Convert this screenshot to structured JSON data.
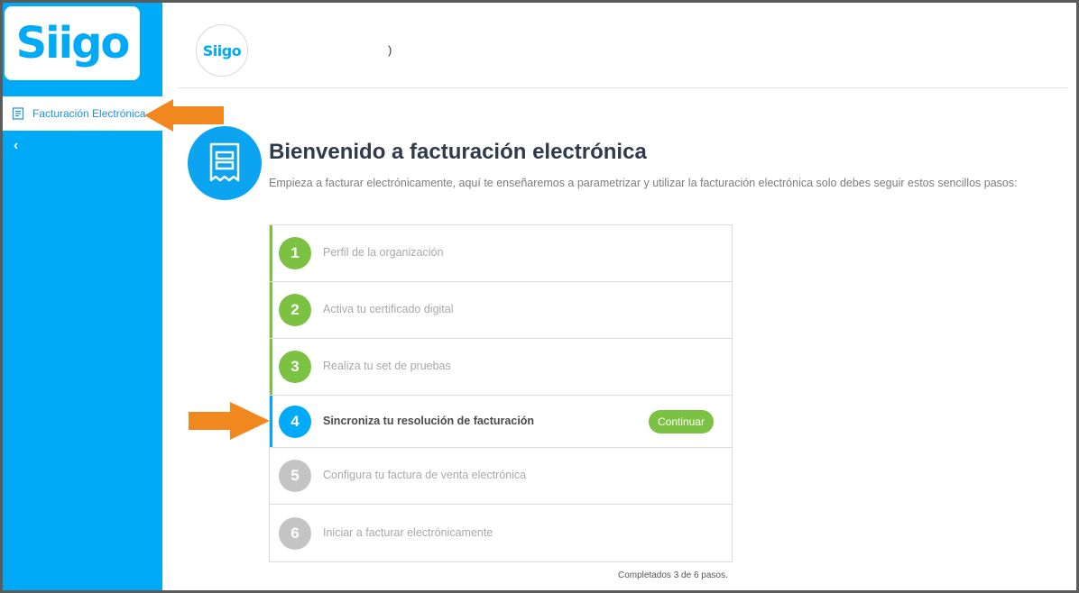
{
  "sidebar": {
    "logo": "Siigo",
    "menu_label": "Facturación Electrónica",
    "collapse_glyph": "‹"
  },
  "header": {
    "avatar_logo": "Siigo",
    "user_text": ")"
  },
  "hero": {
    "title": "Bienvenido a facturación electrónica",
    "subtitle": "Empieza a facturar electrónicamente, aquí te enseñaremos a parametrizar y utilizar la facturación electrónica solo debes seguir estos sencillos pasos:"
  },
  "steps": [
    {
      "num": "1",
      "label": "Perfil de la organización",
      "status": "done"
    },
    {
      "num": "2",
      "label": "Activa tu certificado digital",
      "status": "done"
    },
    {
      "num": "3",
      "label": "Realiza tu set de pruebas",
      "status": "done"
    },
    {
      "num": "4",
      "label": "Sincroniza tu resolución de facturación",
      "status": "current"
    },
    {
      "num": "5",
      "label": "Configura tu factura de venta electrónica",
      "status": "pending"
    },
    {
      "num": "6",
      "label": "Iniciar a facturar electrónicamente",
      "status": "pending"
    }
  ],
  "continue_label": "Continuar",
  "progress_text": "Completados 3 de 6 pasos.",
  "colors": {
    "brand": "#00aaf7",
    "done": "#7cc242",
    "pending": "#c4c4c4",
    "annotation_arrow": "#f0881f"
  },
  "icons": [
    "receipt-icon",
    "chevron-left-icon",
    "arrow-pointer-icon"
  ]
}
